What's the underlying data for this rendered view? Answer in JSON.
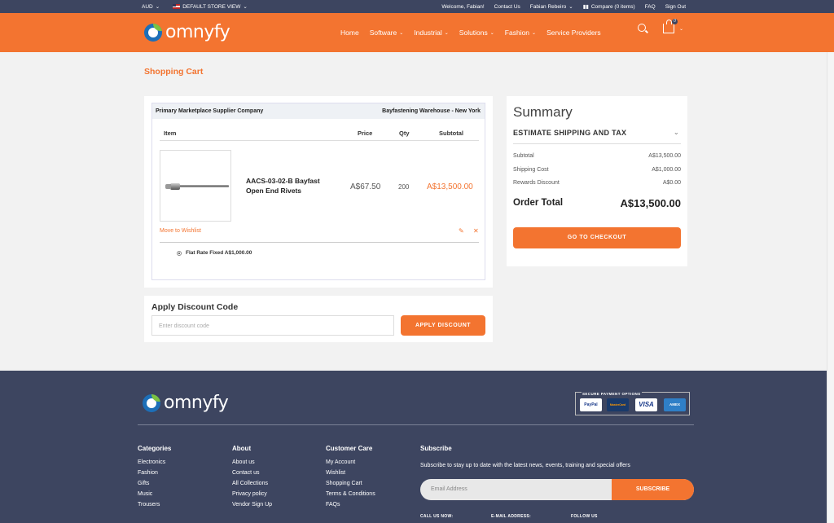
{
  "topbar": {
    "currency": "AUD",
    "store_view": "DEFAULT STORE VIEW",
    "welcome": "Welcome, Fabian!",
    "contact": "Contact Us",
    "user": "Fabian Rebeiro",
    "compare": "Compare (0 items)",
    "faq": "FAQ",
    "signout": "Sign Out"
  },
  "header": {
    "logo_text": "omnyfy",
    "nav": [
      "Home",
      "Software",
      "Industrial",
      "Solutions",
      "Fashion",
      "Service Providers"
    ],
    "cart_count": "0"
  },
  "page": {
    "title": "Shopping Cart"
  },
  "cart": {
    "supplier": "Primary Marketplace Supplier Company",
    "warehouse": "Bayfastening Warehouse - New York",
    "headers": {
      "item": "Item",
      "price": "Price",
      "qty": "Qty",
      "subtotal": "Subtotal"
    },
    "item": {
      "name": "AACS-03-02-B Bayfast Open End Rivets",
      "price": "A$67.50",
      "qty": "200",
      "subtotal": "A$13,500.00",
      "move_wishlist": "Move to Wishlist"
    },
    "shipping_option": "Flat Rate Fixed A$1,000.00"
  },
  "discount": {
    "title": "Apply Discount Code",
    "placeholder": "Enter discount code",
    "button": "APPLY DISCOUNT"
  },
  "summary": {
    "title": "Summary",
    "estimate": "ESTIMATE SHIPPING AND TAX",
    "rows": [
      {
        "label": "Subtotal",
        "value": "A$13,500.00"
      },
      {
        "label": "Shipping Cost",
        "value": "A$1,000.00"
      },
      {
        "label": "Rewards Discount",
        "value": "A$0.00"
      }
    ],
    "total_label": "Order Total",
    "total_value": "A$13,500.00",
    "checkout": "GO TO CHECKOUT"
  },
  "footer": {
    "logo_text": "omnyfy",
    "payment_title": "SECURE PAYMENT OPTIONS",
    "cards": [
      "PayPal",
      "MasterCard",
      "VISA",
      "AMEX"
    ],
    "columns": [
      {
        "title": "Categories",
        "items": [
          "Electronics",
          "Fashion",
          "Gifts",
          "Music",
          "Trousers"
        ]
      },
      {
        "title": "About",
        "items": [
          "About us",
          "Contact us",
          "All Collections",
          "Privacy policy",
          "Vendor Sign Up"
        ]
      },
      {
        "title": "Customer Care",
        "items": [
          "My Account",
          "Wishlist",
          "Shopping Cart",
          "Terms & Conditions",
          "FAQs"
        ]
      }
    ],
    "subscribe": {
      "title": "Subscribe",
      "text": "Subscribe to stay up to date with the latest news, events, training and special offers",
      "placeholder": "Email Address",
      "button": "SUBSCRIBE"
    },
    "info": {
      "call": "CALL US NOW:",
      "email": "E-MAIL ADDRESS:",
      "follow": "FOLLOW US"
    }
  },
  "colors": {
    "brand": "#f37430",
    "dark": "#3d4560"
  }
}
